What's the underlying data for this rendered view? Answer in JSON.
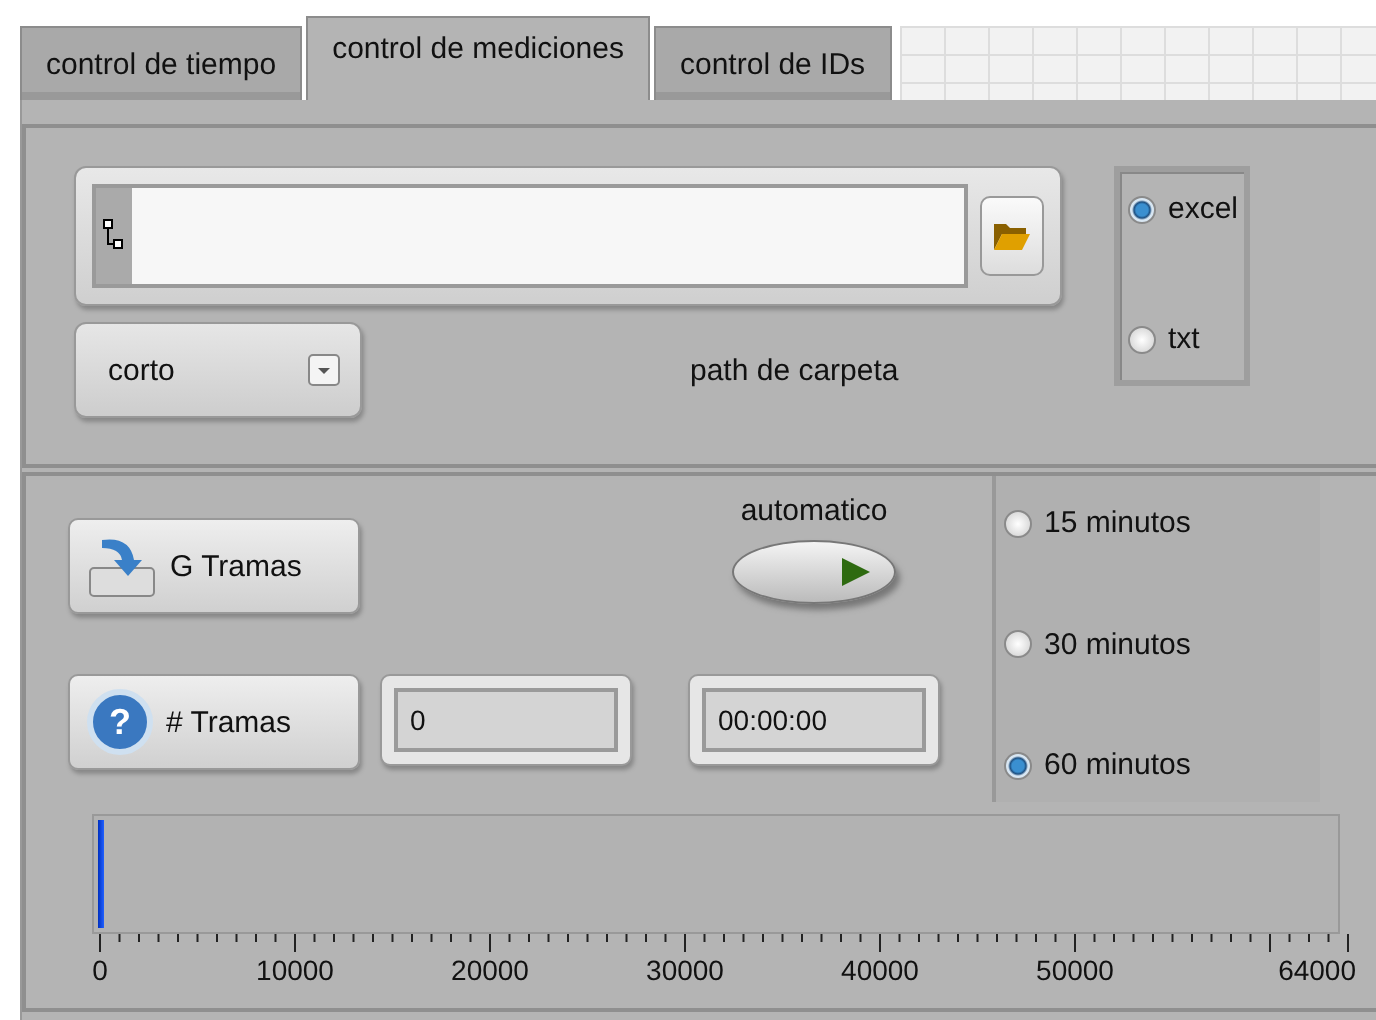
{
  "tabs": [
    {
      "label": "control de tiempo",
      "selected": false
    },
    {
      "label": "control de mediciones",
      "selected": true
    },
    {
      "label": "control de IDs",
      "selected": false
    }
  ],
  "path_field": {
    "label": "path de carpeta"
  },
  "mode_select": {
    "value": "corto"
  },
  "format_options": [
    {
      "label": "excel",
      "selected": true
    },
    {
      "label": "txt",
      "selected": false
    }
  ],
  "buttons": [
    {
      "kind": "save",
      "label": "G Tramas"
    },
    {
      "kind": "help",
      "label": "# Tramas",
      "icon_glyph": "?"
    }
  ],
  "frame_count": {
    "value": "0"
  },
  "auto_toggle": {
    "label": "automatico",
    "on": false
  },
  "elapsed": {
    "value": "00:00:00"
  },
  "interval_options": [
    {
      "label": "15 minutos",
      "selected": false
    },
    {
      "label": "30 minutos",
      "selected": false
    },
    {
      "label": "60 minutos",
      "selected": true
    }
  ],
  "progress": {
    "level": 0,
    "scale": [
      "0",
      "10000",
      "20000",
      "30000",
      "40000",
      "50000",
      "64000"
    ]
  }
}
